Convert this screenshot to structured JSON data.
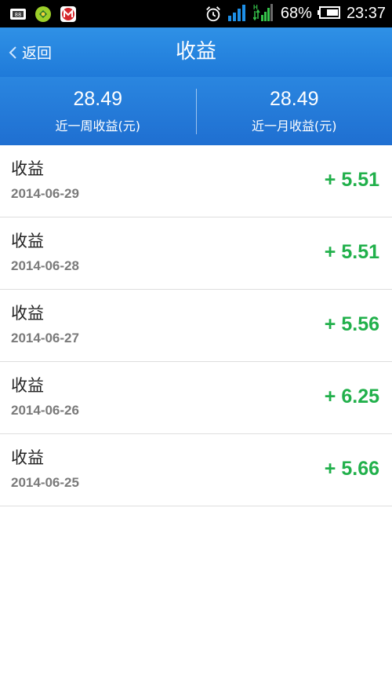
{
  "status_bar": {
    "battery_percent": "68%",
    "time": "23:37",
    "network_type": "H",
    "colors": {
      "signal_blue": "#1e8fe6",
      "signal_green": "#35c24a"
    }
  },
  "header": {
    "back_label": "返回",
    "title": "收益"
  },
  "summary": {
    "week": {
      "value": "28.49",
      "label": "近一周收益(元)"
    },
    "month": {
      "value": "28.49",
      "label": "近一月收益(元)"
    }
  },
  "earnings": [
    {
      "title": "收益",
      "date": "2014-06-29",
      "amount": "+ 5.51"
    },
    {
      "title": "收益",
      "date": "2014-06-28",
      "amount": "+ 5.51"
    },
    {
      "title": "收益",
      "date": "2014-06-27",
      "amount": "+ 5.56"
    },
    {
      "title": "收益",
      "date": "2014-06-26",
      "amount": "+ 6.25"
    },
    {
      "title": "收益",
      "date": "2014-06-25",
      "amount": "+ 5.66"
    }
  ],
  "colors": {
    "header_blue": "#2f91e6",
    "amount_green": "#21b04b"
  }
}
